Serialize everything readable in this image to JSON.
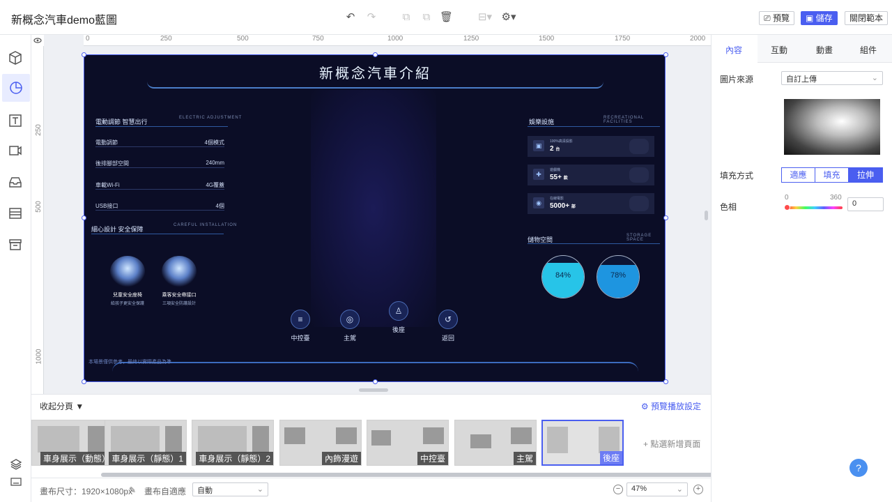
{
  "app": {
    "title": "新概念汽車demo藍圖"
  },
  "toolbar": {
    "preview": "預覽",
    "save": "儲存",
    "close": "關閉範本"
  },
  "ruler": {
    "top": [
      "0",
      "250",
      "500",
      "750",
      "1000",
      "1250",
      "1500",
      "1750",
      "2000"
    ],
    "left": [
      "250",
      "500",
      "1000"
    ]
  },
  "stage": {
    "title": "新概念汽車介紹",
    "left_top": {
      "title": "電動調節 智慧出行",
      "sub": "ELECTRIC ADJUSTMENT"
    },
    "specs": [
      {
        "label": "電動調節",
        "value": "4個模式"
      },
      {
        "label": "後排腳部空間",
        "value": "240mm"
      },
      {
        "label": "車載Wi-Fi",
        "value": "4G覆蓋"
      },
      {
        "label": "USB接口",
        "value": "4個"
      }
    ],
    "left_mid": {
      "title": "細心設計 安全保障",
      "sub": "CAREFUL INSTALLATION"
    },
    "seats": [
      {
        "name": "兒童安全座椅",
        "desc": "給孩子更安全保護"
      },
      {
        "name": "乘客安全帶接口",
        "desc": "三項安全防護設計"
      }
    ],
    "right_top": {
      "title": "娛樂設施",
      "sub": "RECREATIONAL FACILITIES"
    },
    "facilities": [
      {
        "label": "100%高清投影",
        "value": "2",
        "unit": "台"
      },
      {
        "label": "遊戲機",
        "value": "55+",
        "unit": "款"
      },
      {
        "label": "在線電影",
        "value": "5000+",
        "unit": "部"
      }
    ],
    "right_mid": {
      "title": "儲物空間",
      "sub": "STORAGE SPACE"
    },
    "storage": [
      {
        "percent": "84%",
        "fill": 0.84,
        "color": "#27c4e8"
      },
      {
        "percent": "78%",
        "fill": 0.78,
        "color": "#1e95e0"
      }
    ],
    "nav": [
      {
        "label": "中控臺",
        "icon": "≡"
      },
      {
        "label": "主駕",
        "icon": "◎"
      },
      {
        "label": "後座",
        "icon": "♙"
      },
      {
        "label": "返回",
        "icon": "↺"
      }
    ],
    "footnote": "本場景僅供參考，最終以實際產品為準"
  },
  "pages": {
    "collapse": "收起分頁",
    "preview_settings": "預覽播放設定",
    "add_page": "點選新增頁面",
    "thumbs": [
      {
        "label": "車身展示（動態）"
      },
      {
        "label": "車身展示（靜態）1"
      },
      {
        "label": "車身展示（靜態）2"
      },
      {
        "label": "內飾漫遊"
      },
      {
        "label": "中控臺"
      },
      {
        "label": "主駕"
      },
      {
        "label": "後座"
      }
    ]
  },
  "status": {
    "canvas_size": "畫布尺寸：1920×1080px",
    "adapt_label": "畫布自適應",
    "adapt_value": "自動",
    "zoom": "47%"
  },
  "panel": {
    "tabs": [
      "內容",
      "互動",
      "動畫",
      "組件"
    ],
    "image_source_label": "圖片來源",
    "image_source_value": "自訂上傳",
    "fill_label": "填充方式",
    "fill_options": [
      "適應",
      "填充",
      "拉伸"
    ],
    "hue_label": "色相",
    "hue_min": "0",
    "hue_max": "360",
    "hue_value": "0"
  },
  "colors": {
    "accent": "#4a5ef0",
    "stage_bg": "#0b0d26"
  }
}
